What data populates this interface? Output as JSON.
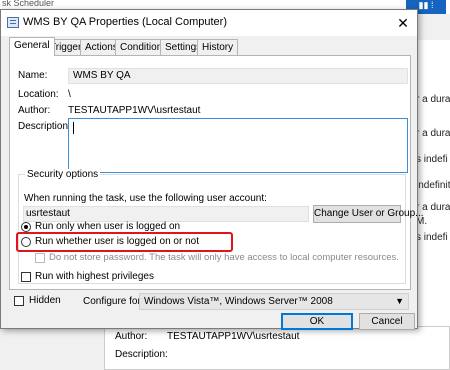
{
  "background": {
    "title": "sk Scheduler",
    "right_texts": [
      "r a dura",
      "r a dura",
      "s indefi",
      "indefinit",
      "r a dura",
      "M.",
      "s indefi"
    ],
    "bottom": {
      "author_label": "Author:",
      "author_value": "TESTAUTAPP1WV\\usrtestaut",
      "description_label": "Description:"
    }
  },
  "dialog": {
    "title": "WMS BY QA Properties (Local Computer)",
    "close": "✕",
    "tabs": [
      "General",
      "Triggers",
      "Actions",
      "Conditions",
      "Settings",
      "History"
    ],
    "general": {
      "name_label": "Name:",
      "name_value": "WMS BY QA",
      "location_label": "Location:",
      "location_value": "\\",
      "author_label": "Author:",
      "author_value": "TESTAUTAPP1WV\\usrtestaut",
      "description_label": "Description:",
      "description_value": ""
    },
    "security": {
      "group_title": "Security options",
      "account_prompt": "When running the task, use the following user account:",
      "account_value": "usrtestaut",
      "change_button": "Change User or Group...",
      "radio_logged_on": "Run only when user is logged on",
      "radio_whether": "Run whether user is logged on or not",
      "no_store_password": "Do not store password.  The task will only have access to local computer resources.",
      "highest_privileges": "Run with highest privileges"
    },
    "hidden_label": "Hidden",
    "configure_label": "Configure for:",
    "configure_value": "Windows Vista™, Windows Server™ 2008",
    "ok_button": "OK",
    "cancel_button": "Cancel"
  }
}
